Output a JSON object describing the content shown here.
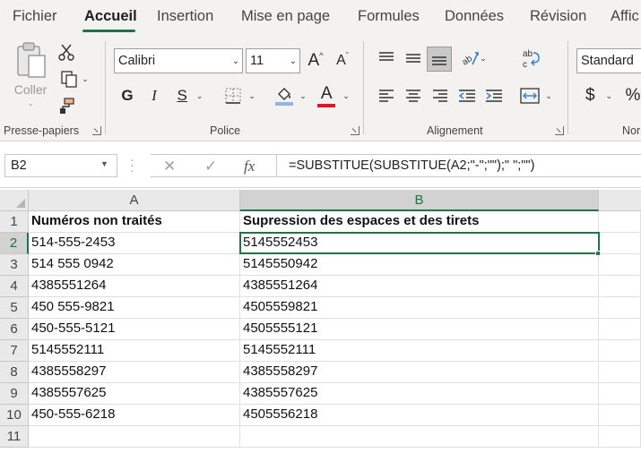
{
  "tabs": [
    "Fichier",
    "Accueil",
    "Insertion",
    "Mise en page",
    "Formules",
    "Données",
    "Révision",
    "Affic"
  ],
  "active_tab": "Accueil",
  "accent_color": "#217346",
  "ribbon": {
    "clipboard": {
      "label": "Presse-papiers",
      "paste_label": "Coller",
      "icons": [
        "paste-icon",
        "cut-icon",
        "copy-icon",
        "format-painter-icon"
      ]
    },
    "font": {
      "label": "Police",
      "font_name": "Calibri",
      "font_size": "11",
      "bold_glyph": "G",
      "italic_glyph": "I",
      "underline_glyph": "S",
      "grow_glyph": "A",
      "shrink_glyph": "A",
      "font_color_glyph": "A",
      "font_color": "#e81123",
      "fill_color": "#8fb4e6",
      "icons": [
        "grow-font-icon",
        "shrink-font-icon",
        "borders-icon",
        "fill-color-icon",
        "font-color-icon"
      ]
    },
    "alignment": {
      "label": "Alignement",
      "icons": [
        "align-top-icon",
        "align-middle-icon",
        "align-bottom-icon",
        "orientation-icon",
        "wrap-text-icon",
        "align-left-icon",
        "align-center-icon",
        "align-right-icon",
        "decrease-indent-icon",
        "increase-indent-icon",
        "merge-center-icon"
      ]
    },
    "number": {
      "label": "Nor",
      "format": "Standard",
      "currency_glyph": "$",
      "percent_glyph": "%"
    }
  },
  "formula_bar": {
    "name_box": "B2",
    "cancel_glyph": "✕",
    "enter_glyph": "✓",
    "fx_glyph": "fx",
    "formula": "=SUBSTITUE(SUBSTITUE(A2;\"-\";\"\");\" \";\"\")"
  },
  "sheet": {
    "columns": [
      "A",
      "B"
    ],
    "selected_column": "B",
    "selected_row": "2",
    "row_numbers": [
      "1",
      "2",
      "3",
      "4",
      "5",
      "6",
      "7",
      "8",
      "9",
      "10",
      "11"
    ],
    "rows": [
      [
        "Numéros non traités",
        "Supression des espaces et des tirets"
      ],
      [
        "514-555-2453",
        "5145552453"
      ],
      [
        "514 555 0942",
        "5145550942"
      ],
      [
        "4385551264",
        "4385551264"
      ],
      [
        "450 555-9821",
        "4505559821"
      ],
      [
        "450-555-5121",
        "4505555121"
      ],
      [
        "5145552111",
        "5145552111"
      ],
      [
        "4385558297",
        "4385558297"
      ],
      [
        "4385557625",
        "4385557625"
      ],
      [
        "450-555-6218",
        "4505556218"
      ],
      [
        "",
        ""
      ]
    ]
  }
}
